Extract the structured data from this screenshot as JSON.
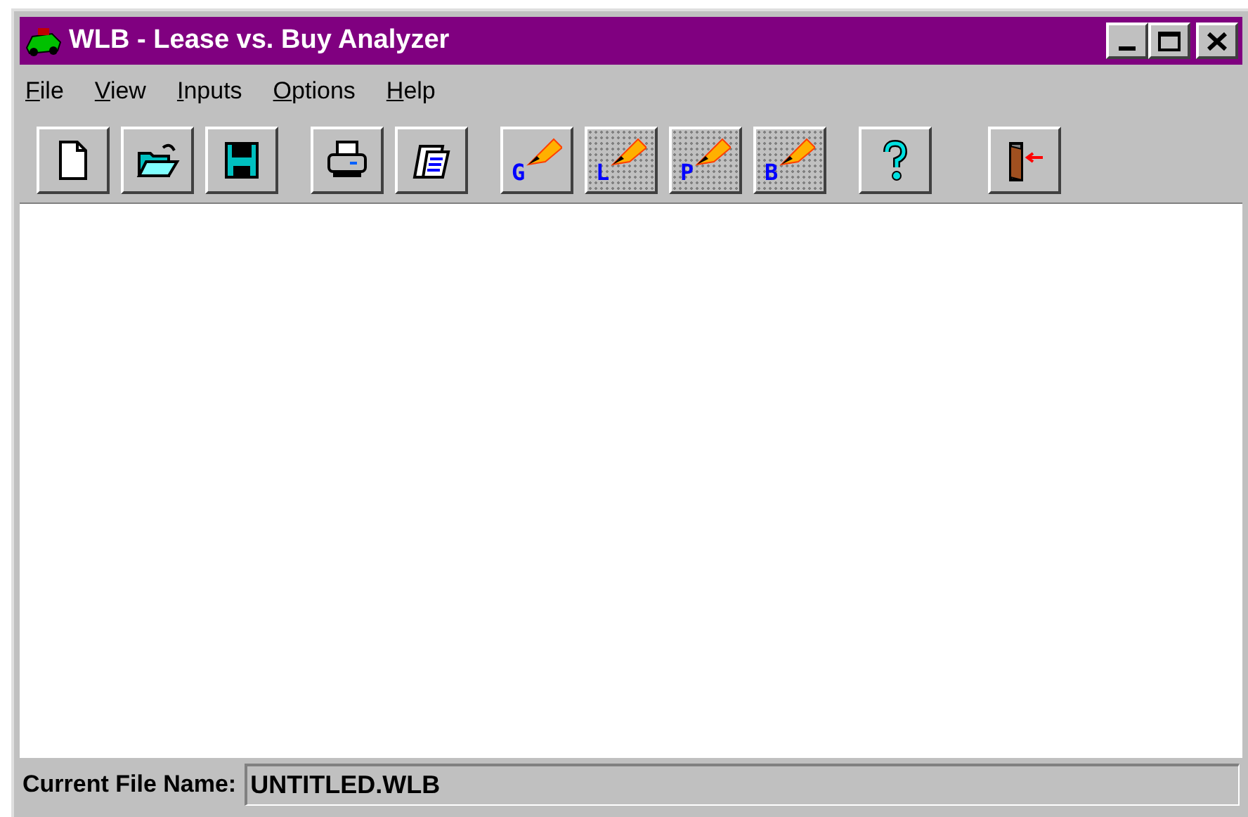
{
  "window": {
    "title": "WLB - Lease vs. Buy Analyzer"
  },
  "menu": [
    "File",
    "View",
    "Inputs",
    "Options",
    "Help"
  ],
  "toolbar": [
    {
      "kind": "new"
    },
    {
      "kind": "open"
    },
    {
      "kind": "save"
    },
    {
      "kind": "print"
    },
    {
      "kind": "notes"
    },
    {
      "kind": "chart",
      "letter": "G"
    },
    {
      "kind": "chart",
      "letter": "L"
    },
    {
      "kind": "chart",
      "letter": "P"
    },
    {
      "kind": "chart",
      "letter": "B"
    },
    {
      "kind": "help"
    },
    {
      "kind": "exit"
    }
  ],
  "status_bar": {
    "label": "Current File Name:",
    "value": "UNTITLED.WLB"
  }
}
